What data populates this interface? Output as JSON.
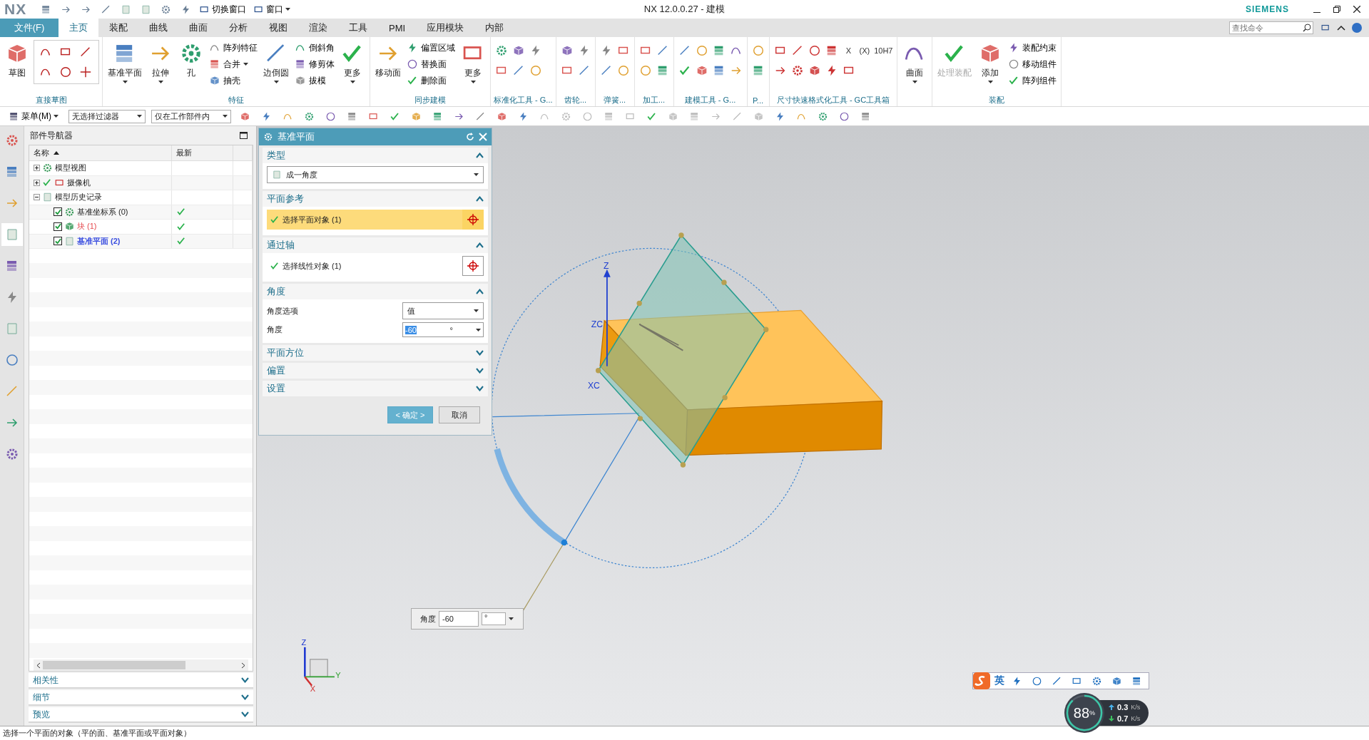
{
  "title_bar": {
    "logo": "NX",
    "quick_buttons": [
      {
        "label": "切换窗口",
        "caret": false
      },
      {
        "label": "窗口",
        "caret": true
      }
    ],
    "title": "NX 12.0.0.27 - 建模",
    "brand": "SIEMENS"
  },
  "menu_tabs": [
    {
      "label": "文件(F)",
      "kind": "file",
      "selected": false
    },
    {
      "label": "主页",
      "kind": "tab",
      "selected": true
    },
    {
      "label": "装配",
      "kind": "tab",
      "selected": false
    },
    {
      "label": "曲线",
      "kind": "tab",
      "selected": false
    },
    {
      "label": "曲面",
      "kind": "tab",
      "selected": false
    },
    {
      "label": "分析",
      "kind": "tab",
      "selected": false
    },
    {
      "label": "视图",
      "kind": "tab",
      "selected": false
    },
    {
      "label": "渲染",
      "kind": "tab",
      "selected": false
    },
    {
      "label": "工具",
      "kind": "tab",
      "selected": false
    },
    {
      "label": "PMI",
      "kind": "tab",
      "selected": false
    },
    {
      "label": "应用模块",
      "kind": "tab",
      "selected": false
    },
    {
      "label": "内部",
      "kind": "tab",
      "selected": false
    }
  ],
  "search": {
    "placeholder": "查找命令"
  },
  "ribbon_groups": [
    {
      "title": "直接草图",
      "kind": "sketch",
      "items": [
        {
          "kind": "large",
          "label": "草图",
          "caret": false,
          "disabled": false
        }
      ]
    },
    {
      "title": "特征",
      "kind": "tools",
      "items": [
        {
          "kind": "large",
          "label": "基准平面",
          "caret": true,
          "disabled": false
        },
        {
          "kind": "large",
          "label": "拉伸",
          "caret": true,
          "disabled": false
        },
        {
          "kind": "large",
          "label": "孔",
          "caret": false,
          "disabled": false
        },
        {
          "kind": "small",
          "label": "阵列特征",
          "caret": false,
          "disabled": false
        },
        {
          "kind": "small",
          "label": "合并",
          "caret": true,
          "disabled": false
        },
        {
          "kind": "small",
          "label": "抽壳",
          "caret": false,
          "disabled": false
        },
        {
          "kind": "large",
          "label": "边倒圆",
          "caret": true,
          "disabled": false
        },
        {
          "kind": "small",
          "label": "倒斜角",
          "caret": false,
          "disabled": false
        },
        {
          "kind": "small",
          "label": "修剪体",
          "caret": false,
          "disabled": false
        },
        {
          "kind": "small",
          "label": "拔模",
          "caret": false,
          "disabled": false
        },
        {
          "kind": "large",
          "label": "更多",
          "caret": true,
          "disabled": false
        }
      ]
    },
    {
      "title": "同步建模",
      "kind": "tools",
      "items": [
        {
          "kind": "large",
          "label": "移动面",
          "caret": false,
          "disabled": false
        },
        {
          "kind": "small",
          "label": "偏置区域",
          "caret": false,
          "disabled": false
        },
        {
          "kind": "small",
          "label": "替换面",
          "caret": false,
          "disabled": false
        },
        {
          "kind": "small",
          "label": "删除面",
          "caret": false,
          "disabled": false
        },
        {
          "kind": "large",
          "label": "更多",
          "caret": true,
          "disabled": false
        }
      ]
    },
    {
      "title": "标准化工具 - G...",
      "kind": "icons"
    },
    {
      "title": "齿轮...",
      "kind": "icons"
    },
    {
      "title": "弹簧...",
      "kind": "icons"
    },
    {
      "title": "加工...",
      "kind": "icons"
    },
    {
      "title": "建模工具 - G...",
      "kind": "icons"
    },
    {
      "title": "P...",
      "kind": "icons"
    },
    {
      "title": "尺寸快速格式化工具 - GC工具箱",
      "kind": "glyphs",
      "glyphs": [
        "X",
        "(X)",
        "10H7"
      ]
    },
    {
      "kind": "tools",
      "items": [
        {
          "kind": "large",
          "label": "曲面",
          "caret": true,
          "disabled": false
        }
      ]
    },
    {
      "title": "装配",
      "kind": "tools",
      "items": [
        {
          "kind": "large",
          "label": "处理装配",
          "caret": false,
          "disabled": true
        },
        {
          "kind": "large",
          "label": "添加",
          "caret": true,
          "disabled": false
        },
        {
          "kind": "small",
          "label": "装配约束",
          "caret": false,
          "disabled": false
        },
        {
          "kind": "small",
          "label": "移动组件",
          "caret": false,
          "disabled": false
        },
        {
          "kind": "small",
          "label": "阵列组件",
          "caret": false,
          "disabled": false
        }
      ]
    }
  ],
  "selection_bar": {
    "menu": "菜单(M)",
    "filters": [
      "无选择过滤器",
      "仅在工作部件内"
    ]
  },
  "navigator": {
    "title": "部件导航器",
    "columns": [
      "名称",
      "最新"
    ],
    "tree": [
      {
        "label": "模型视图",
        "kind": "view",
        "expanded": false,
        "visible": false
      },
      {
        "label": "摄像机",
        "kind": "camera",
        "expanded": false,
        "visible": true
      },
      {
        "label": "模型历史记录",
        "kind": "folder",
        "expanded": true,
        "visible": false,
        "children": [
          {
            "label": "基准坐标系 (0)",
            "kind": "csys",
            "checked": true,
            "latest": true,
            "modified": false,
            "current": false
          },
          {
            "label": "块 (1)",
            "kind": "block",
            "checked": true,
            "latest": true,
            "modified": true,
            "current": false
          },
          {
            "label": "基准平面 (2)",
            "kind": "plane",
            "checked": true,
            "latest": true,
            "modified": false,
            "current": true
          }
        ]
      }
    ],
    "panels": [
      {
        "title": "相关性",
        "expanded": false
      },
      {
        "title": "细节",
        "expanded": false
      },
      {
        "title": "预览",
        "expanded": false
      }
    ]
  },
  "dialog": {
    "title": "基准平面",
    "sections": [
      {
        "title": "类型",
        "expanded": true,
        "rows": [
          {
            "kind": "select",
            "value": "成一角度"
          }
        ]
      },
      {
        "title": "平面参考",
        "expanded": true,
        "rows": [
          {
            "kind": "selector",
            "label": "选择平面对象 (1)",
            "done": true,
            "selected": true
          }
        ]
      },
      {
        "title": "通过轴",
        "expanded": true,
        "rows": [
          {
            "kind": "selector",
            "label": "选择线性对象 (1)",
            "done": true,
            "selected": false
          }
        ]
      },
      {
        "title": "角度",
        "expanded": true,
        "rows": [
          {
            "kind": "option",
            "label": "角度选项",
            "value": "值"
          },
          {
            "kind": "number",
            "label": "角度",
            "value": "-60",
            "unit": "°",
            "highlighted": true
          }
        ]
      },
      {
        "title": "平面方位",
        "expanded": false
      },
      {
        "title": "偏置",
        "expanded": false
      },
      {
        "title": "设置",
        "expanded": false
      }
    ],
    "buttons": [
      {
        "label": "< 确定 >",
        "kind": "primary"
      },
      {
        "label": "取消",
        "kind": "secondary"
      }
    ]
  },
  "viewport": {
    "axis_labels": [
      "Z",
      "ZC",
      "XC"
    ],
    "triad_labels": [
      "Z",
      "Y",
      "X"
    ],
    "angle_input": {
      "label": "角度",
      "value": "-60",
      "unit": "°"
    }
  },
  "ime_bar": {
    "mode": "英"
  },
  "net_meter": {
    "percent": "88",
    "percent_unit": "%",
    "level": 0.88,
    "upload": "0.3",
    "upload_unit": "K/s",
    "download": "0.7",
    "download_unit": "K/s"
  },
  "status_bar": {
    "message": "选择一个平面的对象（平的面、基准平面或平面对象）"
  }
}
